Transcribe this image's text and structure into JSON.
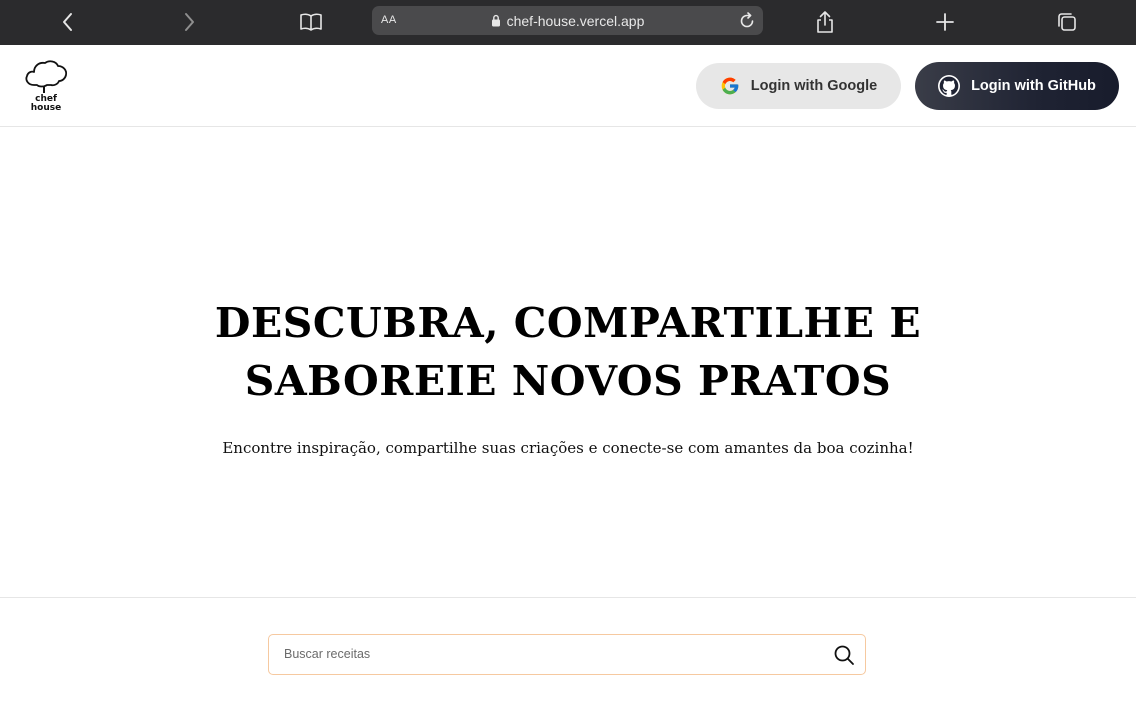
{
  "browser": {
    "text_size_label": "AA",
    "url": "chef-house.vercel.app"
  },
  "header": {
    "logo_line1": "chef",
    "logo_line2": "house",
    "google_button": "Login with Google",
    "github_button": "Login with GitHub"
  },
  "hero": {
    "title_line1": "DESCUBRA, COMPARTILHE E",
    "title_line2": "SABOREIE NOVOS PRATOS",
    "subtitle": "Encontre inspiração, compartilhe suas criações e conecte-se com amantes da boa cozinha!"
  },
  "search": {
    "placeholder": "Buscar receitas",
    "value": ""
  },
  "colors": {
    "chrome_bg": "#2b2b2d",
    "urlbar_bg": "#4a4a4c",
    "google_btn_bg": "#e7e7e7",
    "github_btn_bg": "#1f2333",
    "search_border": "#f6c9a0"
  },
  "icons": [
    "back-icon",
    "forward-icon",
    "bookmarks-icon",
    "lock-icon",
    "reload-icon",
    "share-icon",
    "new-tab-icon",
    "tabs-icon",
    "chef-hat-logo",
    "google-icon",
    "github-icon",
    "search-icon"
  ]
}
